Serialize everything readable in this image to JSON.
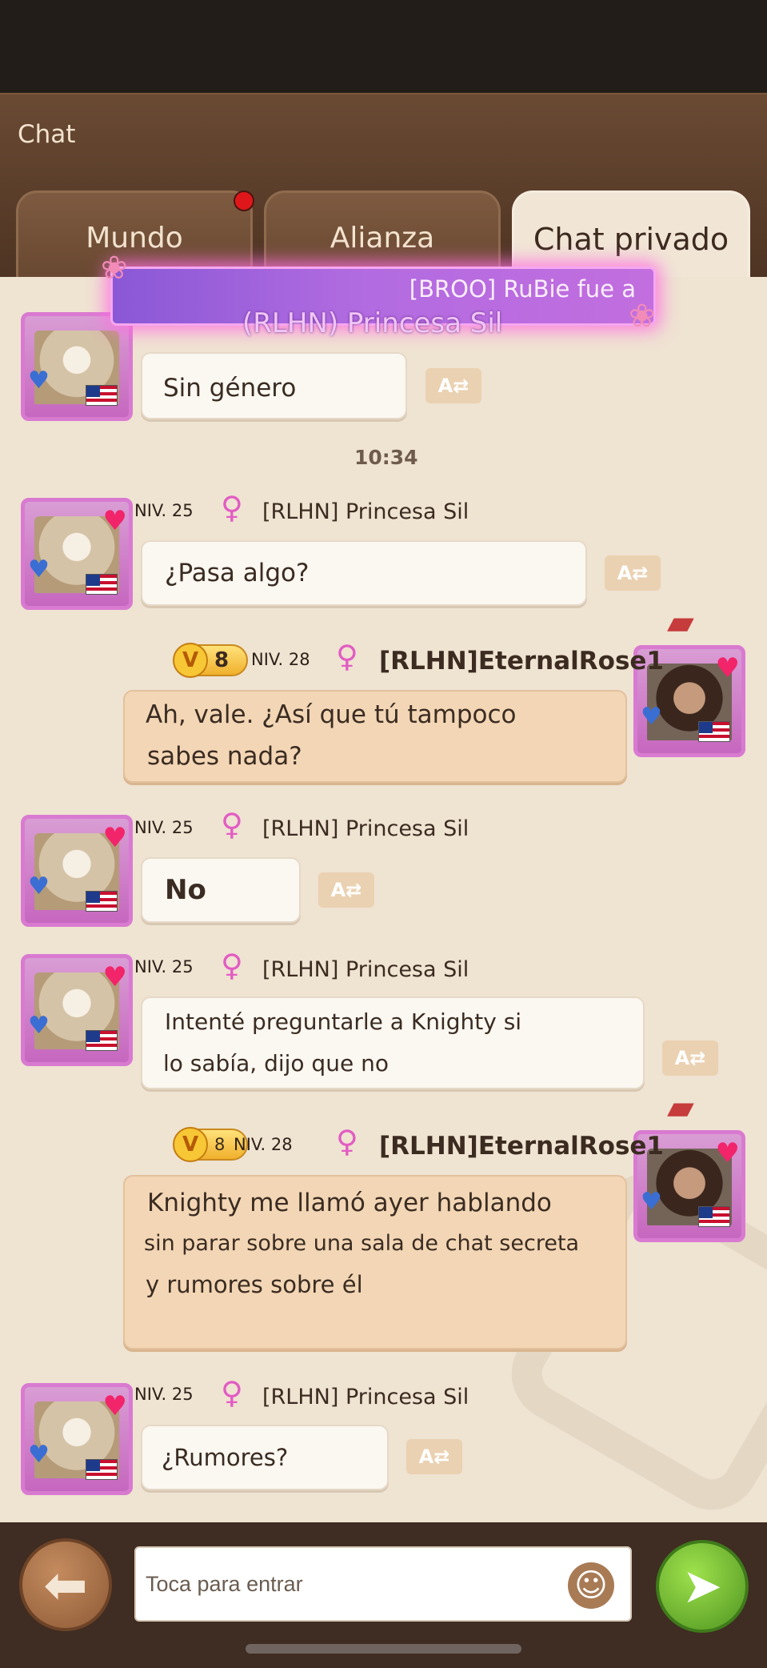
{
  "header": {
    "title": "Chat"
  },
  "tabs": [
    {
      "label": "Mundo",
      "active": false,
      "has_notification": true
    },
    {
      "label": "Alianza",
      "active": false,
      "has_notification": false
    },
    {
      "label": "Chat privado",
      "active": true,
      "has_notification": false
    }
  ],
  "banner": {
    "line1": "[BROO] RuBie fue a",
    "line2": "(RLHN) Princesa Sil"
  },
  "partial_message": {
    "text": "Sin género"
  },
  "timestamp": "10:34",
  "messages": [
    {
      "side": "left",
      "level": "NIV. 25",
      "name": "[RLHN] Princesa Sil",
      "lines": [
        "¿Pasa algo?"
      ]
    },
    {
      "side": "right",
      "level": "NIV. 28",
      "vip": "8",
      "name": "[RLHN]EternalRose1",
      "lines": [
        "Ah, vale. ¿Así que tú tampoco",
        "sabes nada?"
      ]
    },
    {
      "side": "left",
      "level": "NIV. 25",
      "name": "[RLHN] Princesa Sil",
      "lines": [
        "No"
      ]
    },
    {
      "side": "left",
      "level": "NIV. 25",
      "name": "[RLHN] Princesa Sil",
      "lines": [
        "Intenté preguntarle a Knighty si",
        "lo sabía, dijo que no"
      ]
    },
    {
      "side": "right",
      "level": "NIV. 28",
      "vip": "8",
      "name": "[RLHN]EternalRose1",
      "lines": [
        "Knighty me llamó ayer hablando",
        "sin parar sobre una sala de chat secreta",
        "y rumores sobre él"
      ]
    },
    {
      "side": "left",
      "level": "NIV. 25",
      "name": "[RLHN] Princesa Sil",
      "lines": [
        "¿Rumores?"
      ]
    }
  ],
  "input": {
    "placeholder": "Toca para entrar"
  },
  "icons": {
    "back": "back-arrow-icon",
    "send": "send-icon",
    "emoji": "emoji-icon",
    "translate": "translate-icon"
  },
  "colors": {
    "accent_send": "#5fa92a",
    "notification": "#e0171a",
    "mine_bubble": "#f3d6b5",
    "other_bubble": "#fbf7f1",
    "banner": "#a764dd"
  }
}
